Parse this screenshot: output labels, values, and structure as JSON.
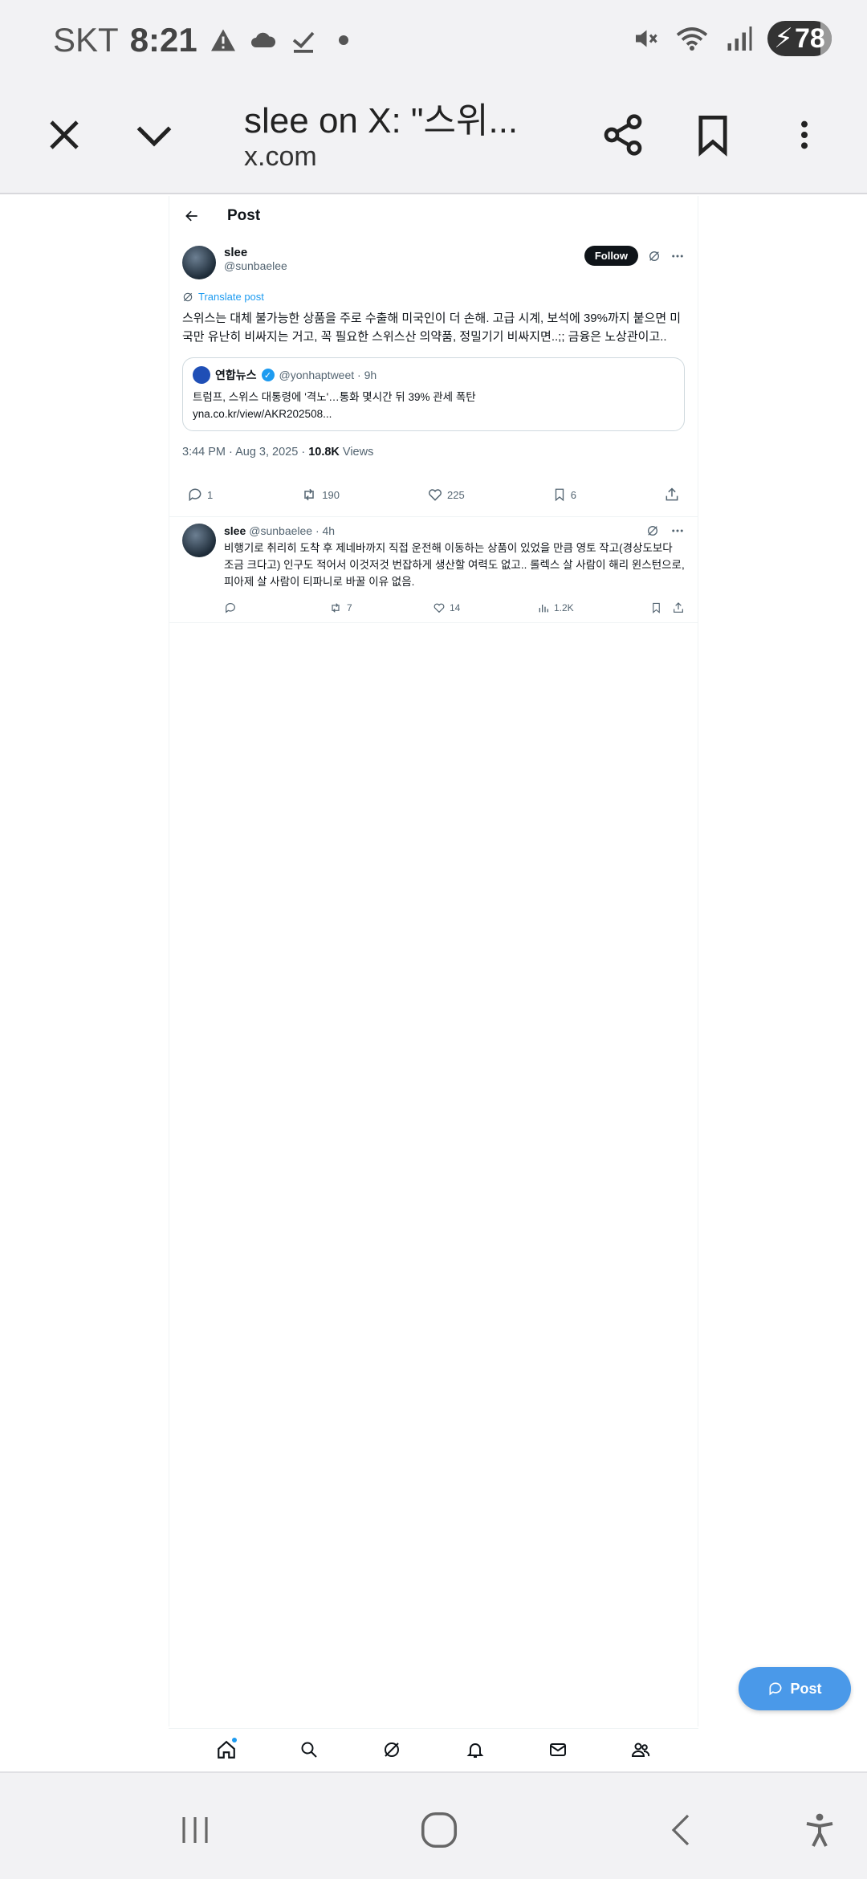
{
  "status_bar": {
    "carrier": "SKT",
    "time": "8:21",
    "battery": "78"
  },
  "browser": {
    "title": "slee on X: \"스위...",
    "url": "x.com"
  },
  "page_header": {
    "title": "Post"
  },
  "tweet": {
    "name": "slee",
    "handle": "@sunbaelee",
    "follow_label": "Follow",
    "translate_label": "Translate post",
    "text": "스위스는 대체 불가능한 상품을 주로 수출해 미국인이 더 손해. 고급 시계, 보석에 39%까지 붙으면 미국만 유난히 비싸지는 거고, 꼭 필요한 스위스산 의약품, 정밀기기 비싸지면..;; 금융은 노상관이고..",
    "quote": {
      "name": "연합뉴스",
      "handle_time": "@yonhaptweet · 9h",
      "text": "트럼프, 스위스 대통령에 '격노'…통화 몇시간 뒤 39% 관세 폭탄",
      "link": "yna.co.kr/view/AKR202508..."
    },
    "timestamp": "3:44 PM · Aug 3, 2025 · ",
    "views_count": "10.8K",
    "views_label": " Views",
    "actions": {
      "replies": "1",
      "reposts": "190",
      "likes": "225",
      "bookmarks": "6"
    }
  },
  "reply": {
    "name": "slee",
    "handle_time": "@sunbaelee · 4h",
    "text": "비행기로 취리히 도착 후 제네바까지 직접 운전해 이동하는 상품이 있었을 만큼 영토 작고(경상도보다 조금 크다고) 인구도 적어서 이것저것 번잡하게 생산할 여력도 없고.. 롤렉스 살 사람이 해리 윈스턴으로, 피아제 살 사람이 티파니로 바꿀 이유 없음.",
    "actions": {
      "reposts": "7",
      "likes": "14",
      "views": "1.2K"
    }
  },
  "fab": {
    "label": "Post"
  }
}
